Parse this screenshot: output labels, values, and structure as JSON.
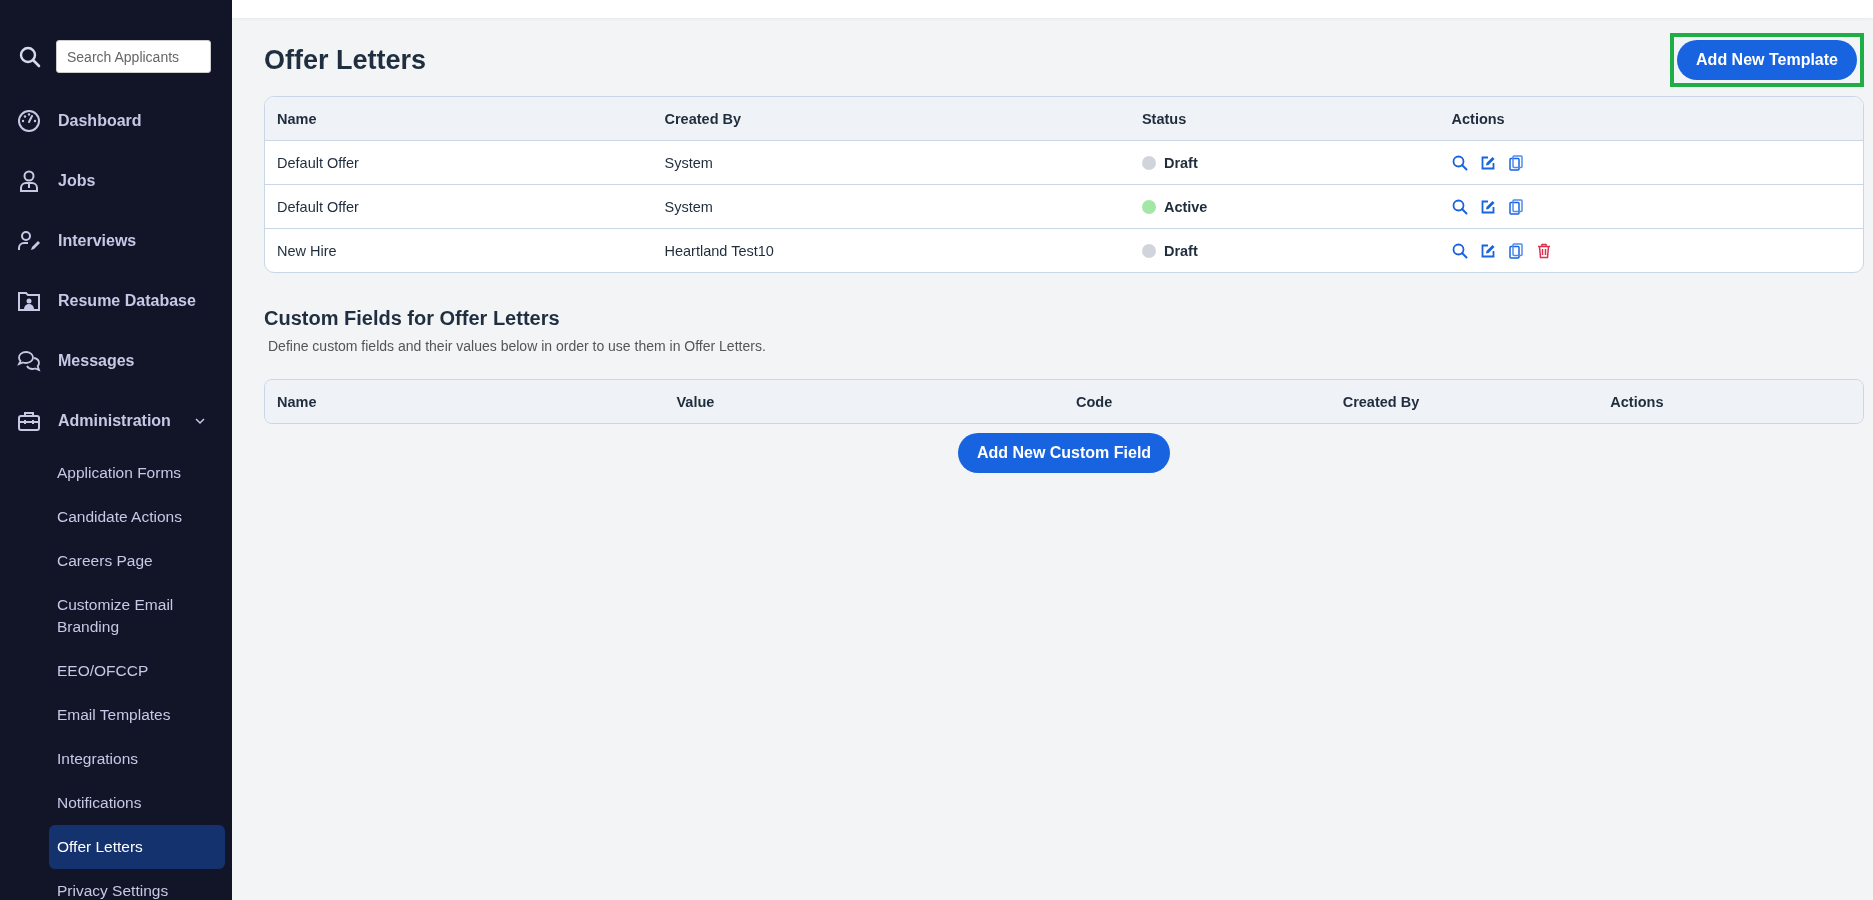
{
  "sidebar": {
    "search": {
      "placeholder": "Search Applicants"
    },
    "items": [
      {
        "label": "Dashboard"
      },
      {
        "label": "Jobs"
      },
      {
        "label": "Interviews"
      },
      {
        "label": "Resume Database"
      },
      {
        "label": "Messages"
      },
      {
        "label": "Administration",
        "expanded": true,
        "children": [
          {
            "label": "Application Forms",
            "selected": false
          },
          {
            "label": "Candidate Actions",
            "selected": false
          },
          {
            "label": "Careers Page",
            "selected": false
          },
          {
            "label": "Customize Email Branding",
            "selected": false
          },
          {
            "label": "EEO/OFCCP",
            "selected": false
          },
          {
            "label": "Email Templates",
            "selected": false
          },
          {
            "label": "Integrations",
            "selected": false
          },
          {
            "label": "Notifications",
            "selected": false
          },
          {
            "label": "Offer Letters",
            "selected": true
          },
          {
            "label": "Privacy Settings",
            "selected": false
          }
        ]
      }
    ]
  },
  "page": {
    "title": "Offer Letters",
    "add_button": {
      "label": "Add New Template",
      "highlighted": true
    }
  },
  "templates": {
    "columns": [
      "Name",
      "Created By",
      "Status",
      "Actions"
    ],
    "rows": [
      {
        "name": "Default Offer",
        "created_by": "System",
        "status": "Draft",
        "color": "#d1d5db",
        "deletable": false
      },
      {
        "name": "Default Offer",
        "created_by": "System",
        "status": "Active",
        "color": "#a3e7a6",
        "deletable": false
      },
      {
        "name": "New Hire",
        "created_by": "Heartland Test10",
        "status": "Draft",
        "color": "#d1d5db",
        "deletable": true
      }
    ]
  },
  "custom_fields": {
    "title": "Custom Fields for Offer Letters",
    "description": "Define custom fields and their values below in order to use them in Offer Letters.",
    "columns": [
      "Name",
      "Value",
      "Code",
      "Created By",
      "Actions"
    ],
    "add_button": "Add New Custom Field"
  }
}
